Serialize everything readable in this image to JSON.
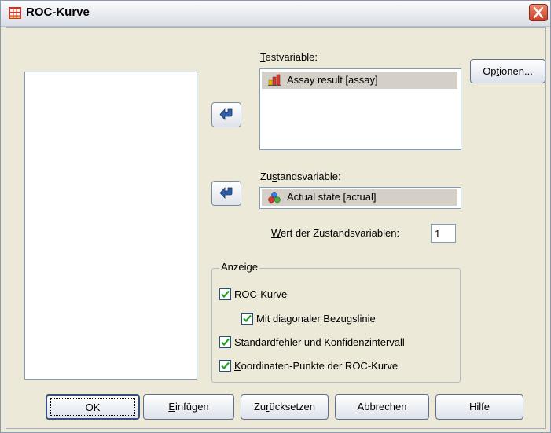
{
  "window": {
    "title": "ROC-Kurve"
  },
  "source_list": {
    "items": []
  },
  "test_variable": {
    "label_pre": "",
    "label_u": "T",
    "label_post": "estvariable:",
    "items": [
      {
        "text": "Assay result [assay]",
        "icon": "scale-variable-icon"
      }
    ]
  },
  "state_variable": {
    "label_pre": "Zu",
    "label_u": "s",
    "label_post": "tandsvariable:",
    "value": "Actual state [actual]",
    "icon": "nominal-variable-icon"
  },
  "state_value": {
    "label_pre": "",
    "label_u": "W",
    "label_post": "ert der Zustandsvariablen:",
    "value": "1"
  },
  "display": {
    "title": "Anzeige",
    "roc_curve": {
      "pre": "ROC-K",
      "u": "u",
      "post": "rve",
      "checked": true
    },
    "diagonal": {
      "pre": "Mit diagonaler Bezugslinie",
      "u": "",
      "post": "",
      "checked": true
    },
    "std_error": {
      "pre": "Standardf",
      "u": "e",
      "post": "hler und Konfidenzintervall",
      "checked": true
    },
    "coordinates": {
      "pre": "",
      "u": "K",
      "post": "oordinaten-Punkte der ROC-Kurve",
      "checked": true
    }
  },
  "buttons": {
    "options": {
      "pre": "Op",
      "u": "t",
      "post": "ionen..."
    },
    "ok": {
      "pre": "OK",
      "u": "",
      "post": ""
    },
    "paste": {
      "pre": "",
      "u": "E",
      "post": "infügen"
    },
    "reset": {
      "pre": "Zu",
      "u": "r",
      "post": "ücksetzen"
    },
    "cancel": {
      "pre": "Abbrechen",
      "u": "",
      "post": ""
    },
    "help": {
      "pre": "Hilfe",
      "u": "",
      "post": ""
    }
  },
  "colors": {
    "titlebar_bg": "#d9dde4",
    "dialog_bg": "#ece9d8",
    "close_red": "#d5473f",
    "arrow_blue": "#2f5fa6",
    "selection_gray": "#d4d0c8"
  }
}
